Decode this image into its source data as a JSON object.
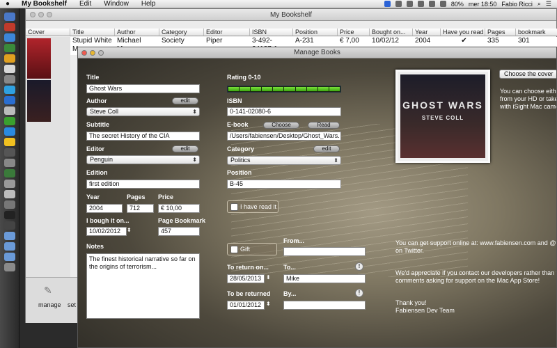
{
  "menubar": {
    "apple": "",
    "app": "My Bookshelf",
    "menus": [
      "Edit",
      "Window",
      "Help"
    ],
    "battery": "80%",
    "clock": "mer 18:50",
    "user": "Fabio Ricci"
  },
  "bg_window": {
    "title": "My Bookshelf",
    "columns": [
      "Cover",
      "Title",
      "Author",
      "Category",
      "Editor",
      "ISBN",
      "Position",
      "Price",
      "Bought on...",
      "Year",
      "Have you read it?",
      "Pages",
      "bookmark"
    ],
    "row": {
      "title": "Stupid White Men",
      "author": "Michael Moore",
      "category": "Society",
      "editor": "Piper",
      "isbn": "3-492-24127-1",
      "position": "A-231",
      "price": "€ 7,00",
      "bought": "10/02/12",
      "year": "2004",
      "read": "✔",
      "pages": "335",
      "bookmark": "301"
    },
    "toolbar": [
      "manage",
      "set"
    ]
  },
  "manage_window": {
    "title": "Manage Books",
    "labels": {
      "title": "Title",
      "author": "Author",
      "subtitle": "Subtitle",
      "editor": "Editor",
      "edition": "Edition",
      "year": "Year",
      "pages": "Pages",
      "price": "Price",
      "bought": "I bough it on...",
      "bookmark": "Page Bookmark",
      "notes": "Notes",
      "rating": "Rating 0-10",
      "isbn": "ISBN",
      "ebook": "E-book",
      "category": "Category",
      "position": "Position",
      "from": "From...",
      "return_on": "To return on...",
      "to": "To...",
      "returned": "To be returned",
      "by": "By..."
    },
    "values": {
      "title": "Ghost Wars",
      "author": "Steve Coll",
      "subtitle": "The secret History of the CIA",
      "editor": "Penguin",
      "edition": "first edition",
      "year": "2004",
      "pages": "712",
      "price": "€ 10,00",
      "bought": "10/02/2012",
      "bookmark": "457",
      "notes": "The finest historical narrative so far on the origins of terrorism...",
      "isbn": "0-141-02080-6",
      "ebook": "/Users/fabiensen/Desktop/Ghost_Wars.",
      "category": "Politics",
      "position": "B-45",
      "return_on": "28/05/2013",
      "to": "Mike",
      "returned": "01/01/2012"
    },
    "rating_value": 10,
    "buttons": {
      "edit": "edit",
      "choose": "Choose",
      "read": "Read",
      "have_read": "I have read it",
      "gift": "Gift",
      "choose_cover": "Choose the cover"
    },
    "cover": {
      "title": "GHOST WARS",
      "author": "STEVE COLL"
    },
    "help_text": {
      "cover_l1": "You can choose eithe",
      "cover_l2": "from your HD or take",
      "cover_l3": "with iSight Mac came",
      "support_l1": "You can get support online at: www.fabiensen.com and @fa",
      "support_l2": "on Twitter.",
      "contact_l1": "We'd appreciate if you contact our developers rather than t",
      "contact_l2": "comments asking for support on the Mac App Store!",
      "thanks_l1": "Thank you!",
      "thanks_l2": "Fabiensen Dev Team"
    }
  }
}
